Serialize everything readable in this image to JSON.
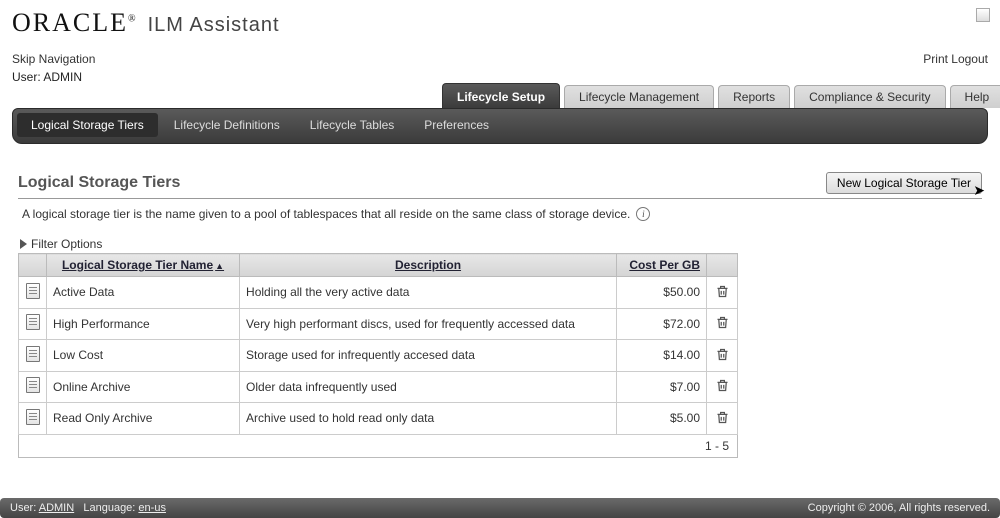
{
  "app": {
    "brand": "ORACLE",
    "registered": "®",
    "title": "ILM Assistant"
  },
  "topLinks": {
    "skipNav": "Skip Navigation",
    "printLogout": "Print Logout"
  },
  "userLine": {
    "label": "User:",
    "value": "ADMIN"
  },
  "primaryTabs": [
    {
      "label": "Lifecycle Setup",
      "active": true
    },
    {
      "label": "Lifecycle Management",
      "active": false
    },
    {
      "label": "Reports",
      "active": false
    },
    {
      "label": "Compliance & Security",
      "active": false
    },
    {
      "label": "Help",
      "active": false
    }
  ],
  "subTabs": [
    {
      "label": "Logical Storage Tiers",
      "active": true
    },
    {
      "label": "Lifecycle Definitions",
      "active": false
    },
    {
      "label": "Lifecycle Tables",
      "active": false
    },
    {
      "label": "Preferences",
      "active": false
    }
  ],
  "section": {
    "title": "Logical Storage Tiers",
    "newButton": "New Logical Storage Tier",
    "description": "A logical storage tier is the name given to a pool of tablespaces that all reside on the same class of storage device.",
    "filterLabel": "Filter Options"
  },
  "table": {
    "columns": {
      "name": "Logical Storage Tier Name",
      "desc": "Description",
      "cost": "Cost Per GB"
    },
    "rows": [
      {
        "name": "Active Data",
        "desc": "Holding all the very active data",
        "cost": "$50.00"
      },
      {
        "name": "High Performance",
        "desc": "Very high performant discs, used for frequently accessed data",
        "cost": "$72.00"
      },
      {
        "name": "Low Cost",
        "desc": "Storage used for infrequently accesed data",
        "cost": "$14.00"
      },
      {
        "name": "Online Archive",
        "desc": "Older data infrequently used",
        "cost": "$7.00"
      },
      {
        "name": "Read Only Archive",
        "desc": "Archive used to hold read only data",
        "cost": "$5.00"
      }
    ],
    "range": "1 - 5"
  },
  "footer": {
    "userLabel": "User:",
    "userValue": "ADMIN",
    "langLabel": "Language:",
    "langValue": "en-us",
    "copyright": "Copyright © 2006, All rights reserved."
  }
}
